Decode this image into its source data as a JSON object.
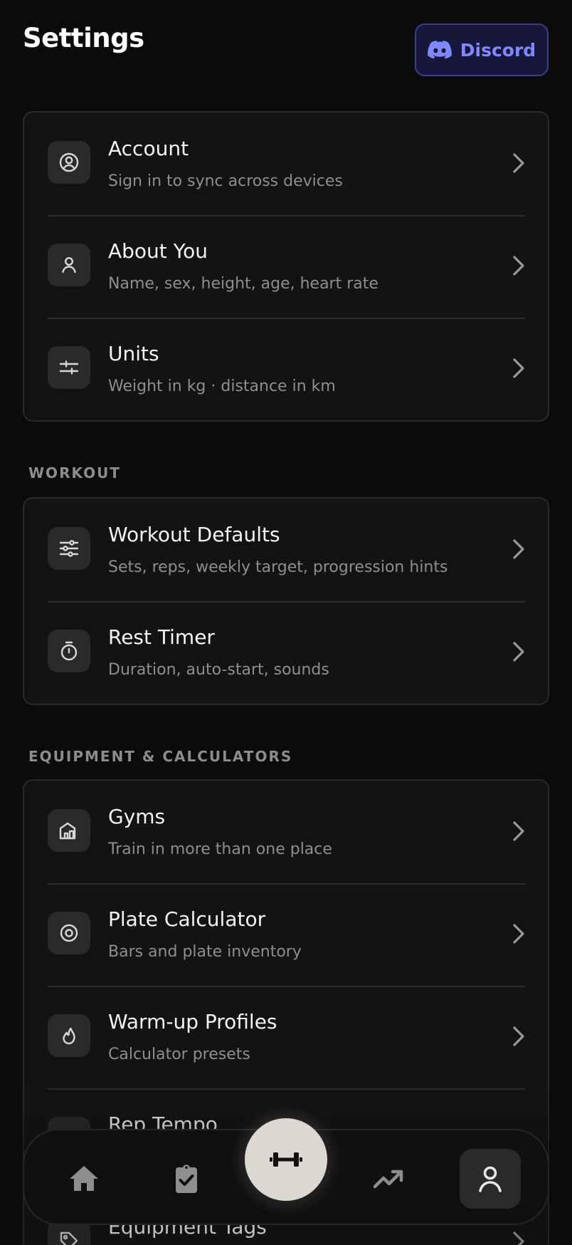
{
  "header": {
    "title": "Settings",
    "discord_label": "Discord"
  },
  "colors": {
    "background": "#0b0b0b",
    "card": "#131313",
    "discord_accent": "#7f88ff",
    "fab": "#dcd7d1"
  },
  "groups": [
    {
      "label": "",
      "items": [
        {
          "icon": "account-circle-icon",
          "title": "Account",
          "subtitle": "Sign in to sync across devices"
        },
        {
          "icon": "person-icon",
          "title": "About You",
          "subtitle": "Name, sex, height, age, heart rate"
        },
        {
          "icon": "sliders-icon",
          "title": "Units",
          "subtitle": "Weight in kg · distance in km"
        }
      ]
    },
    {
      "label": "WORKOUT",
      "items": [
        {
          "icon": "equalizer-icon",
          "title": "Workout Defaults",
          "subtitle": "Sets, reps, weekly target, progression hints"
        },
        {
          "icon": "timer-icon",
          "title": "Rest Timer",
          "subtitle": "Duration, auto-start, sounds"
        }
      ]
    },
    {
      "label": "EQUIPMENT & CALCULATORS",
      "items": [
        {
          "icon": "gym-icon",
          "title": "Gyms",
          "subtitle": "Train in more than one place"
        },
        {
          "icon": "plate-icon",
          "title": "Plate Calculator",
          "subtitle": "Bars and plate inventory"
        },
        {
          "icon": "flame-icon",
          "title": "Warm-up Profiles",
          "subtitle": "Calculator presets"
        },
        {
          "icon": "metronome-icon",
          "title": "Rep Tempo",
          "subtitle": ""
        },
        {
          "icon": "tag-icon",
          "title": "Equipment Tags",
          "subtitle": ""
        }
      ]
    }
  ],
  "nav": {
    "items": [
      "home-icon",
      "clipboard-check-icon",
      "dumbbell-icon",
      "trending-up-icon",
      "profile-icon"
    ],
    "active": "profile-icon"
  }
}
